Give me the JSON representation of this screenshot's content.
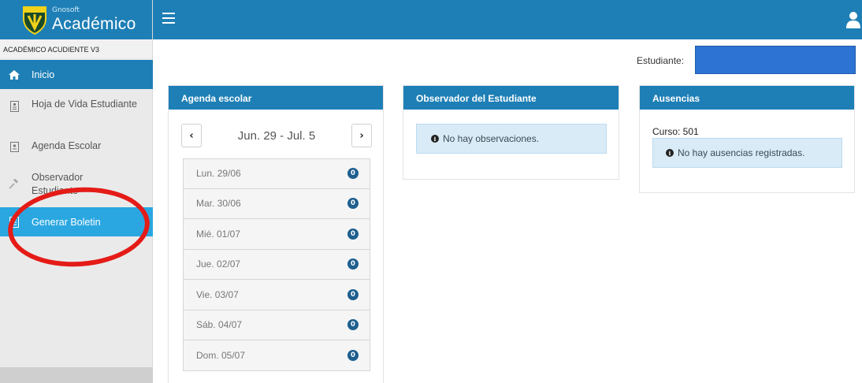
{
  "app": {
    "logo_small": "Gnosoft",
    "logo_big": "Académico",
    "role": "ACADÉMICO ACUDIENTE V3"
  },
  "sidebar": {
    "items": [
      {
        "label": "Inicio",
        "icon": "home-icon"
      },
      {
        "label": "Hoja de Vida Estudiante",
        "icon": "document-icon"
      },
      {
        "label": "Agenda Escolar",
        "icon": "calendar-icon"
      },
      {
        "label": "Observador Estudiante",
        "icon": "gavel-icon"
      },
      {
        "label": "Generar Boletin",
        "icon": "list-icon"
      }
    ]
  },
  "header": {
    "menu_icon": "hamburger-icon",
    "user_icon": "user-icon"
  },
  "student": {
    "label": "Estudiante:",
    "selected": ""
  },
  "agenda": {
    "title": "Agenda escolar",
    "week": "Jun. 29 - Jul. 5",
    "prev": "‹",
    "next": "›",
    "days": [
      {
        "label": "Lun. 29/06",
        "count": "0"
      },
      {
        "label": "Mar. 30/06",
        "count": "0"
      },
      {
        "label": "Mié. 01/07",
        "count": "0"
      },
      {
        "label": "Jue. 02/07",
        "count": "0"
      },
      {
        "label": "Vie. 03/07",
        "count": "0"
      },
      {
        "label": "Sáb. 04/07",
        "count": "0"
      },
      {
        "label": "Dom. 05/07",
        "count": "0"
      }
    ]
  },
  "observador": {
    "title": "Observador del Estudiante",
    "message": "No hay observaciones."
  },
  "ausencias": {
    "title": "Ausencias",
    "curso": "Curso: 501",
    "message": "No hay ausencias registradas."
  },
  "colors": {
    "primary": "#1e7fb6",
    "active": "#2aa7e1",
    "highlight": "#e41b17"
  }
}
